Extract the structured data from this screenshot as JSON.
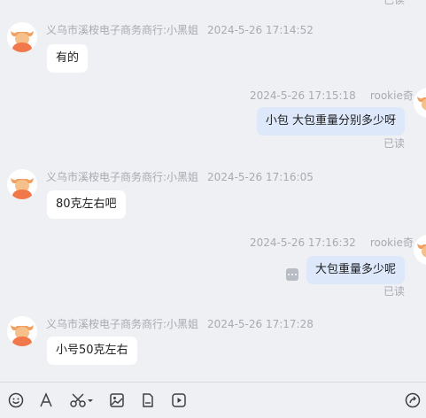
{
  "status": {
    "read_label": "已读"
  },
  "messages": [
    {
      "direction": "in",
      "sender": "义乌市溪桉电子商务商行:小黑姐",
      "time": "2024-5-26 17:14:52",
      "text": "有的"
    },
    {
      "direction": "out",
      "sender": "rookie奇",
      "time": "2024-5-26 17:15:18",
      "text": "小包  大包重量分别多少呀",
      "read": "已读"
    },
    {
      "direction": "in",
      "sender": "义乌市溪桉电子商务商行:小黑姐",
      "time": "2024-5-26 17:16:05",
      "text": "80克左右吧"
    },
    {
      "direction": "out",
      "sender": "rookie奇",
      "time": "2024-5-26 17:16:32",
      "text": "大包重量多少呢",
      "read": "已读"
    },
    {
      "direction": "in",
      "sender": "义乌市溪桉电子商务商行:小黑姐",
      "time": "2024-5-26 17:17:28",
      "text": "小号50克左右"
    }
  ],
  "toolbar": {
    "icons": [
      "emoji-icon",
      "font-icon",
      "scissors-icon",
      "image-icon",
      "file-icon",
      "video-icon",
      "share-icon"
    ]
  },
  "colors": {
    "background": "#eff0f4",
    "incoming_bubble": "#ffffff",
    "outgoing_bubble": "#dde8fb",
    "meta_text": "#a7aab1",
    "avatar_accent": "#f0784a"
  }
}
